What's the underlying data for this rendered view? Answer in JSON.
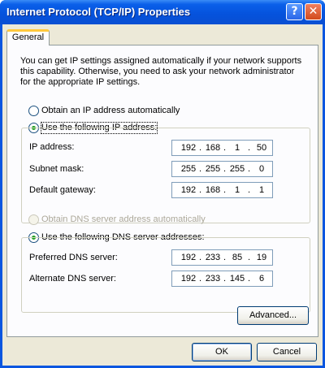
{
  "window": {
    "title": "Internet Protocol (TCP/IP) Properties",
    "help_glyph": "?",
    "close_glyph": "✕"
  },
  "tabs": [
    {
      "label": "General",
      "selected": true
    }
  ],
  "description": "You can get IP settings assigned automatically if your network supports this capability. Otherwise, you need to ask your network administrator for the appropriate IP settings.",
  "ip": {
    "auto_option": {
      "label": "Obtain an IP address automatically",
      "selected": false
    },
    "manual_option": {
      "label": "Use the following IP address:",
      "selected": true
    },
    "fields": [
      {
        "label": "IP address:",
        "octets": [
          "192",
          "168",
          "1",
          "50"
        ]
      },
      {
        "label": "Subnet mask:",
        "octets": [
          "255",
          "255",
          "255",
          "0"
        ]
      },
      {
        "label": "Default gateway:",
        "octets": [
          "192",
          "168",
          "1",
          "1"
        ]
      }
    ]
  },
  "dns": {
    "auto_option": {
      "label": "Obtain DNS server address automatically",
      "selected": false,
      "disabled": true
    },
    "manual_option": {
      "label": "Use the following DNS server addresses:",
      "selected": true
    },
    "fields": [
      {
        "label": "Preferred DNS server:",
        "octets": [
          "192",
          "233",
          "85",
          "19"
        ]
      },
      {
        "label": "Alternate DNS server:",
        "octets": [
          "192",
          "233",
          "145",
          "6"
        ]
      }
    ]
  },
  "buttons": {
    "advanced": "Advanced...",
    "ok": "OK",
    "cancel": "Cancel"
  },
  "colors": {
    "titlebar": "#0a56e0",
    "dialog_bg": "#ece9d8",
    "tab_highlight": "#ffc83c",
    "radio_dot": "#21a121"
  }
}
